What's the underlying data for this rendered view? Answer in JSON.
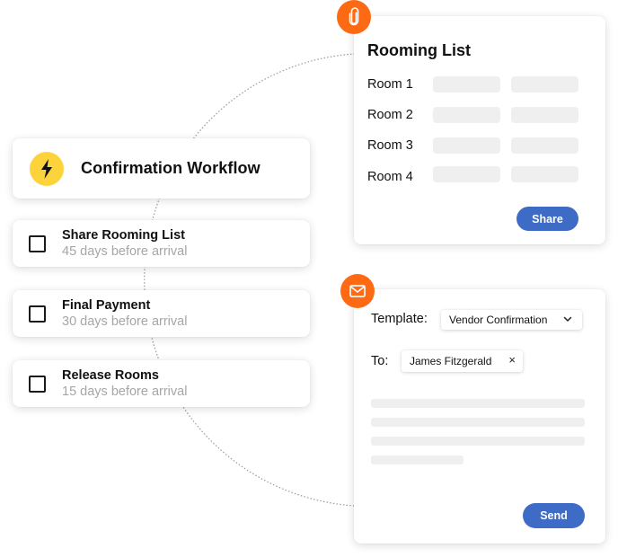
{
  "workflow": {
    "title": "Confirmation Workflow",
    "icon": "lightning-bolt-icon",
    "icon_bg_color": "#fdd33b",
    "tasks": [
      {
        "title": "Share Rooming List",
        "subtitle": "45 days before arrival",
        "checked": false
      },
      {
        "title": "Final Payment",
        "subtitle": "30 days before arrival",
        "checked": false
      },
      {
        "title": "Release Rooms",
        "subtitle": "15 days before arrival",
        "checked": false
      }
    ]
  },
  "rooming_list": {
    "icon": "paperclip-icon",
    "title": "Rooming List",
    "rooms": [
      {
        "label": "Room 1"
      },
      {
        "label": "Room 2"
      },
      {
        "label": "Room 3"
      },
      {
        "label": "Room 4"
      }
    ],
    "share_label": "Share"
  },
  "email": {
    "icon": "mail-icon",
    "template_label": "Template:",
    "template_value": "Vendor Confirmation",
    "to_label": "To:",
    "recipient": "James Fitzgerald",
    "remove_symbol": "×",
    "send_label": "Send"
  },
  "colors": {
    "accent_orange": "#fd6a13",
    "button_blue": "#3e6bc5",
    "bolt_yellow": "#fdd33b",
    "placeholder_gray": "#efefef",
    "muted_text": "#a6a6a6"
  }
}
